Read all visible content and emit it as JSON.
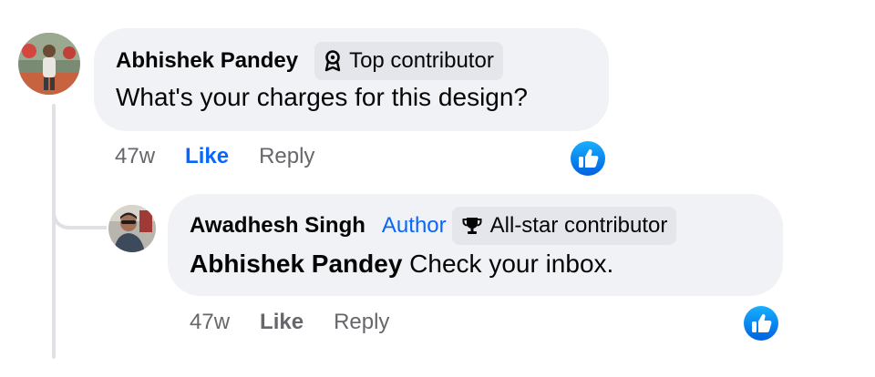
{
  "comment": {
    "author": "Abhishek Pandey",
    "badge": "Top contributor",
    "badge_icon": "medal-icon",
    "text": "What's your charges for this design?",
    "time": "47w",
    "like_label": "Like",
    "like_active": true,
    "reply_label": "Reply",
    "reaction_icon": "thumbs-up-icon"
  },
  "reply": {
    "author": "Awadhesh Singh",
    "author_tag": "Author",
    "badge": "All-star contributor",
    "badge_icon": "trophy-icon",
    "mention": "Abhishek Pandey",
    "text": " Check your inbox.",
    "time": "47w",
    "like_label": "Like",
    "like_active": false,
    "reply_label": "Reply",
    "reaction_icon": "thumbs-up-icon"
  },
  "colors": {
    "accent": "#0866ff",
    "bubble": "#f0f2f5",
    "badge": "#e4e6eb",
    "muted_text": "#65676b",
    "thread_line": "#dfe1e5"
  }
}
